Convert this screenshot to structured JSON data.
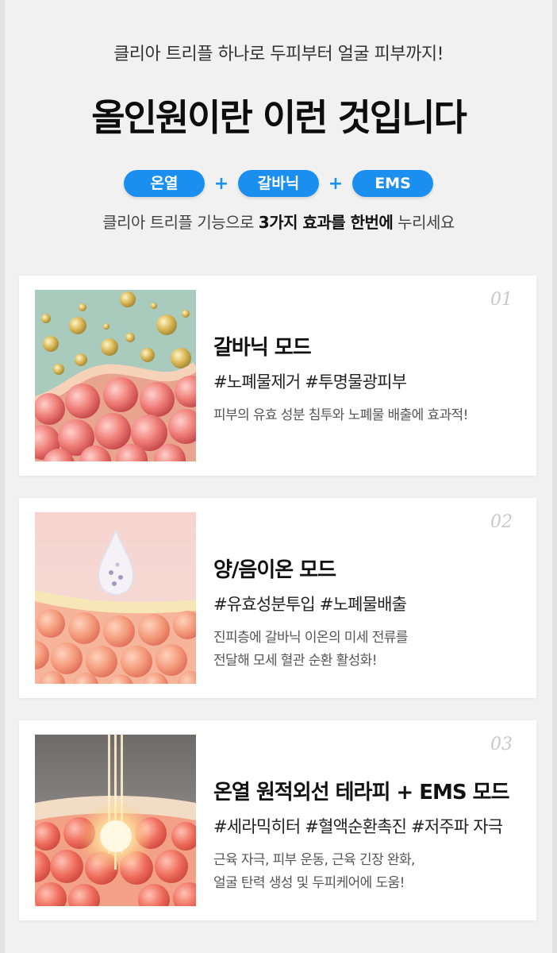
{
  "header": {
    "subtitle": "클리아 트리플 하나로 두피부터 얼굴 피부까지!",
    "title": "올인원이란 이런 것입니다",
    "pills": [
      "온열",
      "갈바닉",
      "EMS"
    ],
    "plus": "+",
    "desc_prefix": "클리아 트리플 기능으로 ",
    "desc_bold": "3가지 효과를 한번에",
    "desc_suffix": " 누리세요"
  },
  "cards": [
    {
      "num": "01",
      "title": "갈바닉 모드",
      "tags": "#노폐물제거 #투명물광피부",
      "desc_lines": [
        "피부의 유효 성분 침투와 노폐물 배출에 효과적!"
      ]
    },
    {
      "num": "02",
      "title": "양/음이온 모드",
      "tags": "#유효성분투입 #노폐물배출",
      "desc_lines": [
        "진피층에 갈바닉 이온의 미세 전류를",
        "전달해 모세 혈관 순환 활성화!"
      ]
    },
    {
      "num": "03",
      "title": "온열 원적외선 테라피 + EMS 모드",
      "tags": "#세라믹히터 #혈액순환촉진 #저주파 자극",
      "desc_lines": [
        "근육 자극, 피부 운동, 근육 긴장 완화,",
        "얼굴 탄력 생성 및 두피케어에 도움!"
      ]
    }
  ],
  "colors": {
    "accent": "#1b8ff0",
    "background": "#f1f1f1"
  },
  "icons": [
    "galvanic-skin-illustration",
    "ion-skin-illustration",
    "infrared-skin-illustration"
  ]
}
